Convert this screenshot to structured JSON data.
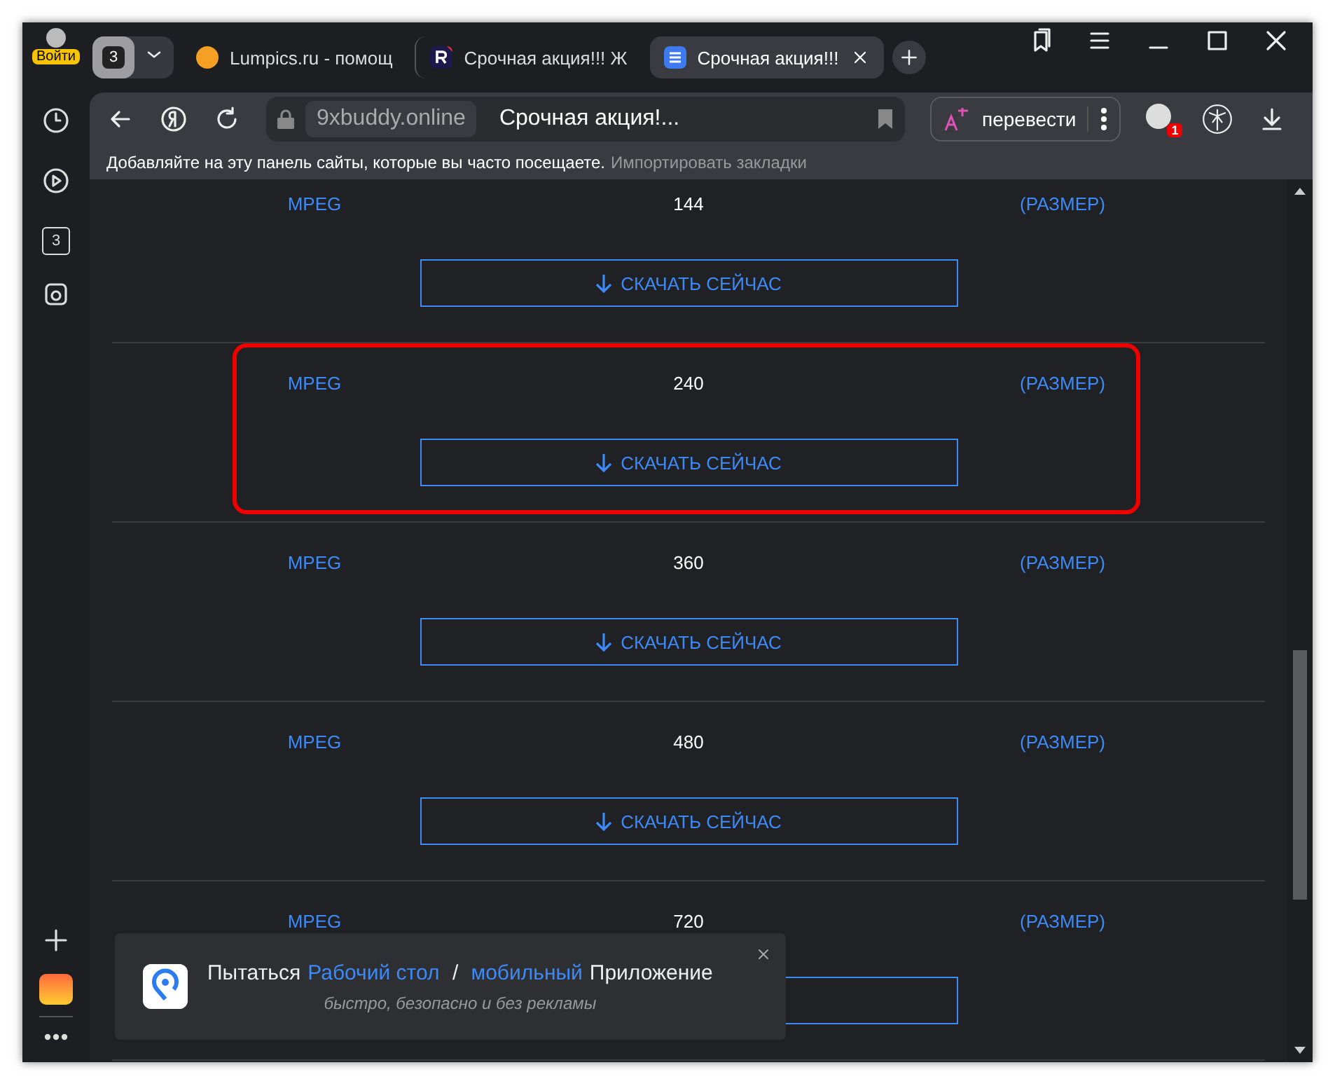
{
  "sidebar": {
    "login": "Войти",
    "tabs_count": "3"
  },
  "tab_strip": {
    "group_count": "3",
    "tabs": [
      {
        "kind": "orange",
        "title": "Lumpics.ru - помощ",
        "selected": false
      },
      {
        "kind": "r-logo",
        "title": "Срочная акция!!! Ж",
        "selected": false
      },
      {
        "kind": "list",
        "title": "Срочная акция!!!",
        "selected": true
      }
    ]
  },
  "toolbar": {
    "domain": "9xbuddy.online",
    "page_title": "Срочная акция!...",
    "translate": "перевести",
    "extension_badge": "1"
  },
  "bookmarks_bar": {
    "hint": "Добавляйте на эту панель сайты, которые вы часто посещаете.",
    "link": "Импортировать закладки"
  },
  "rows": [
    {
      "format": "MPEG",
      "quality": "144",
      "size": "(РАЗМЕР)",
      "button": "СКАЧАТЬ СЕЙЧАС",
      "highlighted": false
    },
    {
      "format": "MPEG",
      "quality": "240",
      "size": "(РАЗМЕР)",
      "button": "СКАЧАТЬ СЕЙЧАС",
      "highlighted": true
    },
    {
      "format": "MPEG",
      "quality": "360",
      "size": "(РАЗМЕР)",
      "button": "СКАЧАТЬ СЕЙЧАС",
      "highlighted": false
    },
    {
      "format": "MPEG",
      "quality": "480",
      "size": "(РАЗМЕР)",
      "button": "СКАЧАТЬ СЕЙЧАС",
      "highlighted": false
    },
    {
      "format": "MPEG",
      "quality": "720",
      "size": "(РАЗМЕР)",
      "highlighted": false
    }
  ],
  "popup": {
    "prefix": "Пытаться",
    "desktop_link": "Рабочий стол",
    "separator": "/",
    "mobile_link": "мобильный",
    "suffix": "Приложение",
    "subtitle": "быстро, безопасно и без рекламы"
  }
}
